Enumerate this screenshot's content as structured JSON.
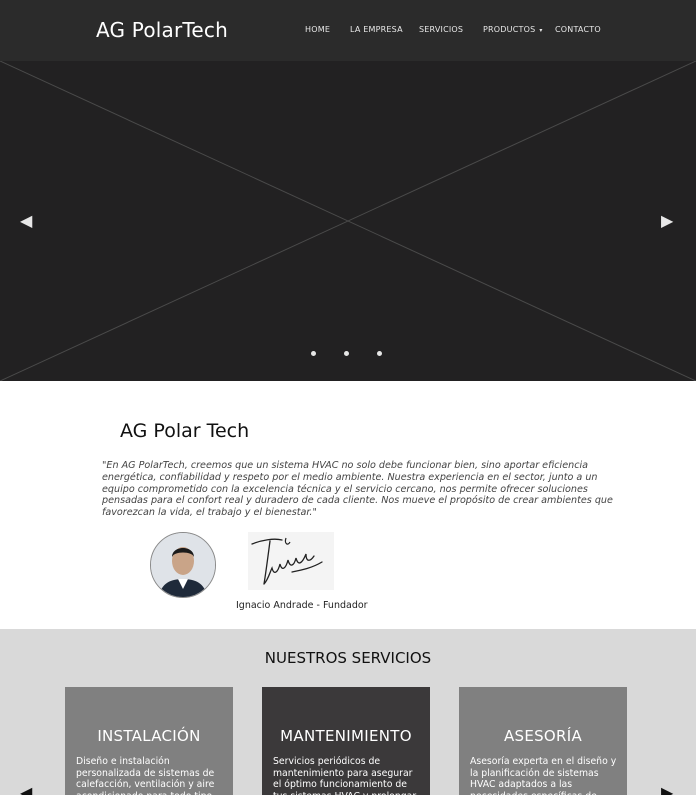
{
  "header": {
    "logo": "AG PolarTech",
    "nav": [
      {
        "label": "HOME"
      },
      {
        "label": "LA EMPRESA"
      },
      {
        "label": "SERVICIOS"
      },
      {
        "label": "PRODUCTOS"
      },
      {
        "label": "CONTACTO"
      }
    ],
    "dropdown_caret": "▾"
  },
  "hero": {
    "prev_arrow": "◀",
    "next_arrow": "▶",
    "slides_count": 3,
    "background_color": "#222122"
  },
  "about": {
    "title": "AG Polar Tech",
    "quote": "\"En AG PolarTech, creemos que un sistema HVAC no solo debe funcionar bien, sino aportar eficiencia energética, confiabilidad y respeto por el medio ambiente. Nuestra experiencia en el sector, junto a un equipo comprometido con la excelencia técnica y el servicio cercano, nos permite ofrecer soluciones pensadas para el confort real y duradero de cada cliente. Nos mueve el propósito de crear ambientes que favorezcan la vida, el trabajo y el bienestar.\"",
    "founder": "Ignacio Andrade - Fundador"
  },
  "services": {
    "title": "NUESTROS SERVICIOS",
    "prev_arrow": "◀",
    "next_arrow": "▶",
    "cards": [
      {
        "title": "INSTALACIÓN",
        "text": "Diseño e instalación personalizada de sistemas de calefacción, ventilación y aire acondicionado para todo tipo de espacios.",
        "color": "#808080"
      },
      {
        "title": "MANTENIMIENTO",
        "text": "Servicios periódicos de mantenimiento para asegurar el óptimo funcionamiento de tus sistemas HVAC y prolongar su vida útil.",
        "color": "#3b393a"
      },
      {
        "title": "ASESORÍA",
        "text": "Asesoría experta en el diseño y la planificación de sistemas HVAC adaptados a las necesidades específicas de cada proyecto.",
        "color": "#808080"
      }
    ]
  }
}
